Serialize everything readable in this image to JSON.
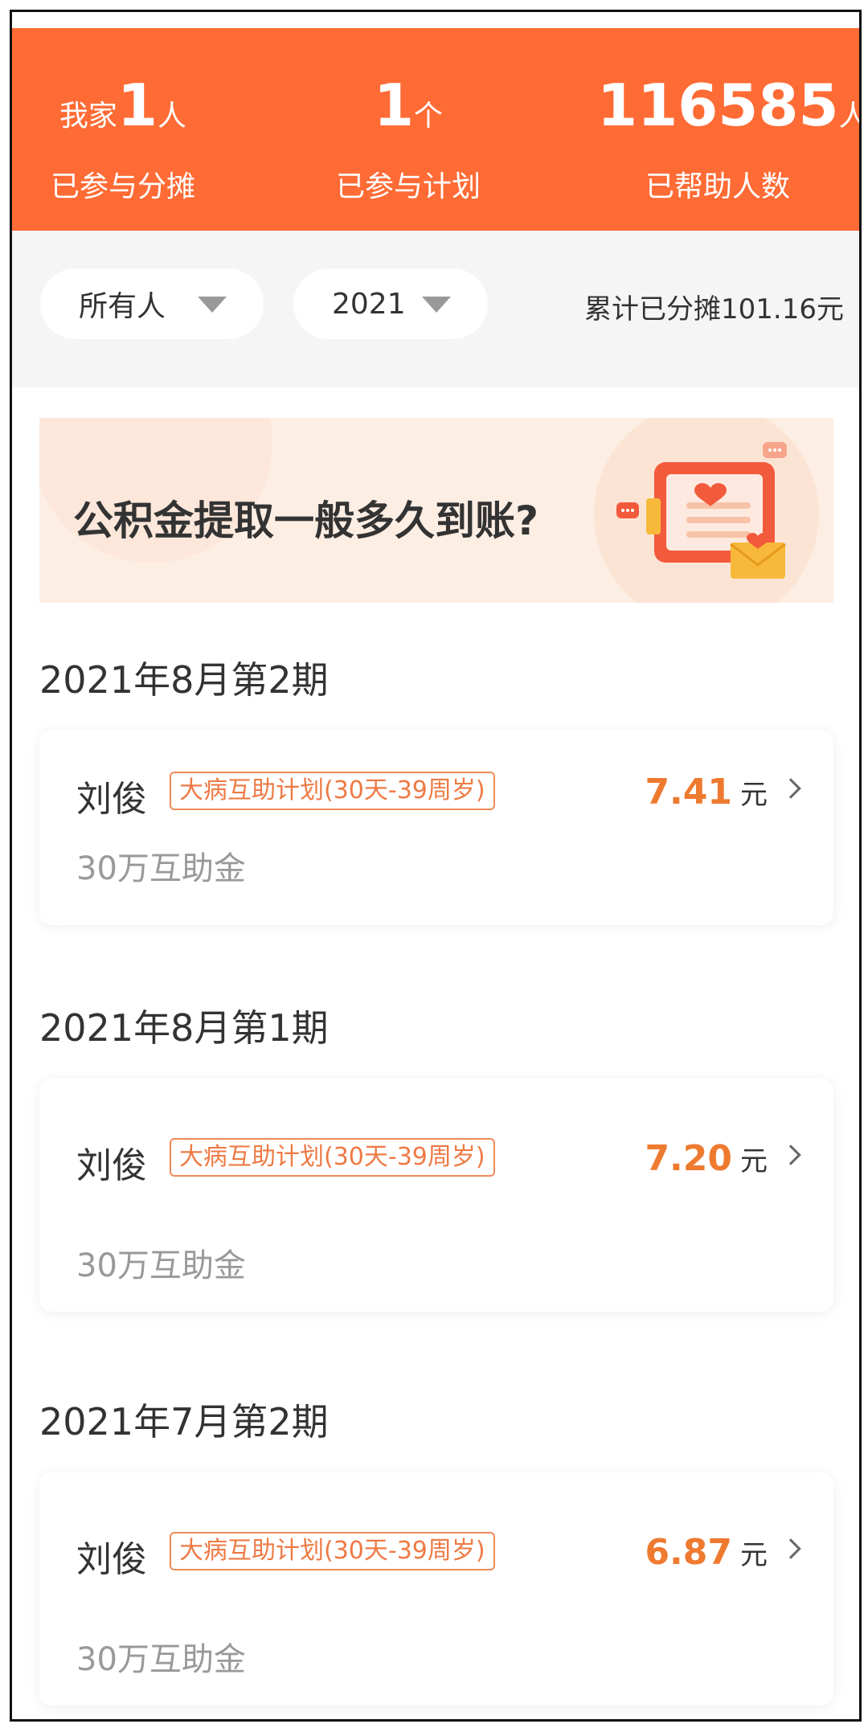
{
  "header": {
    "family": {
      "prefix": "我家",
      "value": "1",
      "suffix": "人",
      "label": "已参与分摊"
    },
    "plans": {
      "prefix": "",
      "value": "1",
      "suffix": "个",
      "label": "已参与计划"
    },
    "helped": {
      "prefix": "",
      "value": "116585",
      "suffix": "人",
      "label": "已帮助人数"
    }
  },
  "filters": {
    "person": "所有人",
    "year": "2021",
    "total_text": "累计已分摊101.16元"
  },
  "banner": {
    "text": "公积金提取一般多久到账?",
    "icon": "document-heart-envelope-illustration"
  },
  "periods": [
    {
      "title": "2021年8月第2期",
      "name": "刘俊",
      "tag": "大病互助计划(30天-39周岁)",
      "amount": "7.41",
      "unit": "元",
      "sub": "30万互助金"
    },
    {
      "title": "2021年8月第1期",
      "name": "刘俊",
      "tag": "大病互助计划(30天-39周岁)",
      "amount": "7.20",
      "unit": "元",
      "sub": "30万互助金"
    },
    {
      "title": "2021年7月第2期",
      "name": "刘俊",
      "tag": "大病互助计划(30天-39周岁)",
      "amount": "6.87",
      "unit": "元",
      "sub": "30万互助金"
    }
  ],
  "colors": {
    "accent": "#ff6b35",
    "amount": "#ee7a30",
    "banner_bg": "#fdeee4"
  }
}
